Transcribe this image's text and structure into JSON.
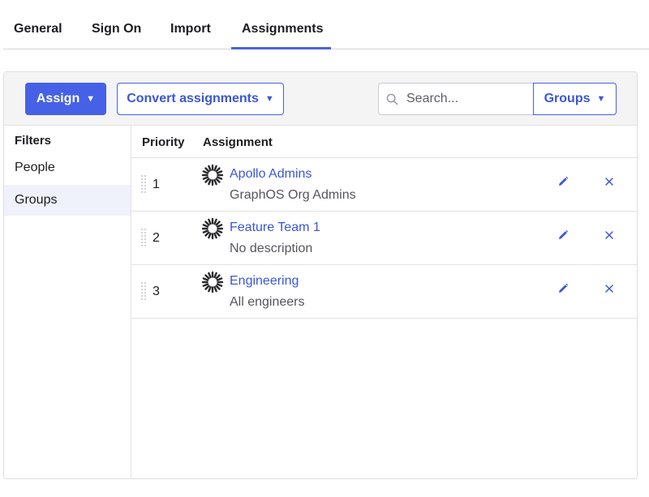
{
  "tabs": [
    {
      "label": "General"
    },
    {
      "label": "Sign On"
    },
    {
      "label": "Import"
    },
    {
      "label": "Assignments"
    }
  ],
  "active_tab": "Assignments",
  "toolbar": {
    "assign_label": "Assign",
    "convert_label": "Convert assignments",
    "caret": "▼",
    "search_placeholder": "Search...",
    "search_value": "",
    "groups_select_label": "Groups"
  },
  "filters": {
    "title": "Filters",
    "items": [
      {
        "label": "People",
        "active": false
      },
      {
        "label": "Groups",
        "active": true
      }
    ]
  },
  "table": {
    "headers": {
      "priority": "Priority",
      "assignment": "Assignment"
    },
    "rows": [
      {
        "priority": "1",
        "name": "Apollo Admins",
        "description": "GraphOS Org Admins",
        "icon": "group-icon"
      },
      {
        "priority": "2",
        "name": "Feature Team 1",
        "description": "No description",
        "icon": "group-icon"
      },
      {
        "priority": "3",
        "name": "Engineering",
        "description": "All engineers",
        "icon": "group-icon"
      }
    ]
  },
  "colors": {
    "accent": "#4661e6",
    "link": "#3b56d9",
    "active_filter_bg": "#eff1fb"
  }
}
